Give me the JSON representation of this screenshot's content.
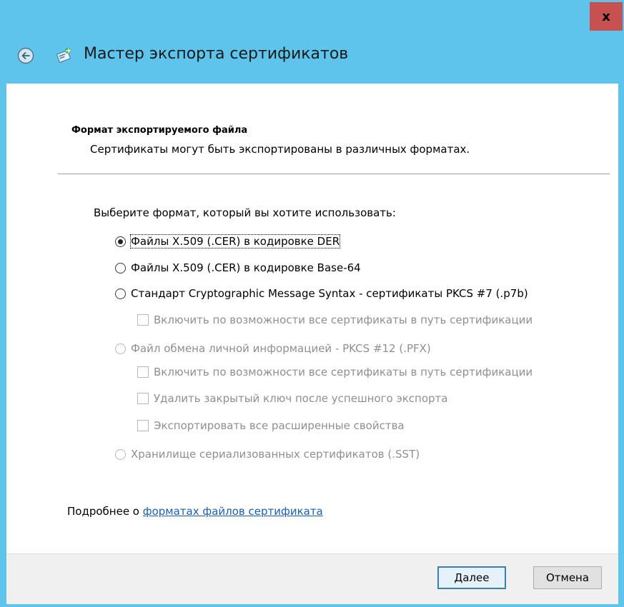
{
  "window": {
    "title": "Мастер экспорта сертификатов",
    "close_label": "x"
  },
  "section": {
    "title": "Формат экспортируемого файла",
    "description": "Сертификаты могут быть экспортированы в различных форматах."
  },
  "prompt": "Выберите формат, который вы хотите использовать:",
  "options": {
    "der": {
      "label": "Файлы X.509 (.CER) в кодировке DER",
      "selected": true
    },
    "base64": {
      "label": "Файлы X.509 (.CER) в кодировке Base-64",
      "selected": false
    },
    "pkcs7": {
      "label": "Стандарт Cryptographic Message Syntax - сертификаты PKCS #7 (.p7b)",
      "selected": false
    },
    "pkcs7_include_all": {
      "label": "Включить по возможности все сертификаты в путь сертификации",
      "checked": false
    },
    "pfx": {
      "label": "Файл обмена личной информацией - PKCS #12 (.PFX)",
      "selected": false
    },
    "pfx_include_all": {
      "label": "Включить по возможности все сертификаты в путь сертификации",
      "checked": false
    },
    "pfx_delete_key": {
      "label": "Удалить закрытый ключ после успешного экспорта",
      "checked": false
    },
    "pfx_export_props": {
      "label": "Экспортировать все расширенные свойства",
      "checked": false
    },
    "sst": {
      "label": "Хранилище сериализованных сертификатов (.SST)",
      "selected": false
    }
  },
  "more_info": {
    "prefix": "Подробнее о ",
    "link": "форматах файлов сертификата"
  },
  "buttons": {
    "next": "Далее",
    "cancel": "Отмена"
  },
  "colors": {
    "frame": "#5ec4ec",
    "close": "#c75050",
    "link": "#1a5fb4",
    "disabled_text": "#8f8f8f"
  },
  "icons": {
    "back": "back-arrow-icon",
    "wizard": "certificate-wizard-icon",
    "close": "close-icon"
  }
}
